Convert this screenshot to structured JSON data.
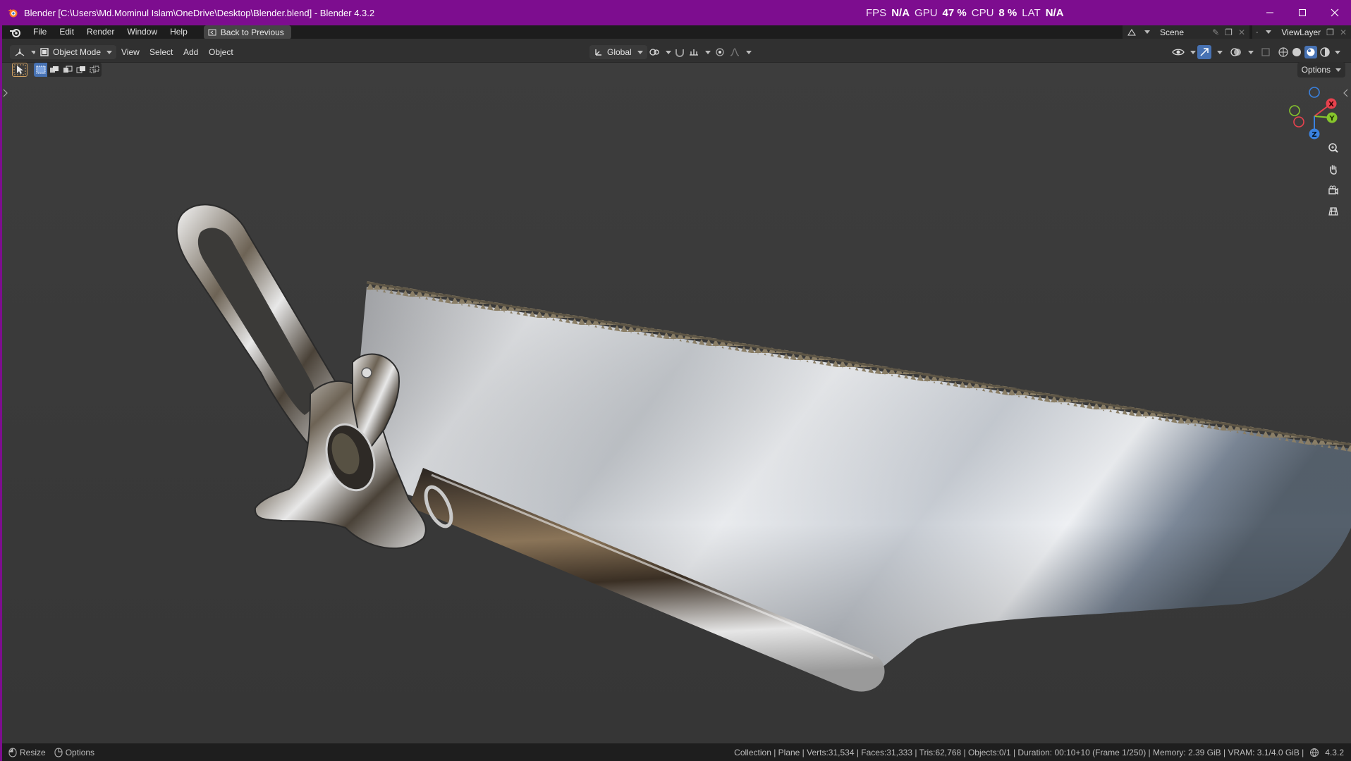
{
  "titlebar": {
    "title": "Blender [C:\\Users\\Md.Mominul Islam\\OneDrive\\Desktop\\Blender.blend] - Blender 4.3.2",
    "perf": {
      "fps_label": "FPS",
      "fps_value": "N/A",
      "gpu_label": "GPU",
      "gpu_value": "47 %",
      "cpu_label": "CPU",
      "cpu_value": "8 %",
      "lat_label": "LAT",
      "lat_value": "N/A"
    },
    "minimize_icon": "minimize-icon",
    "maximize_icon": "maximize-icon",
    "close_icon": "close-icon"
  },
  "menubar": {
    "items": [
      "File",
      "Edit",
      "Render",
      "Window",
      "Help"
    ],
    "back_button": "Back to Previous",
    "scene_name": "Scene",
    "view_layer": "ViewLayer"
  },
  "header": {
    "mode": "Object Mode",
    "menus": [
      "View",
      "Select",
      "Add",
      "Object"
    ],
    "transform_orientation": "Global"
  },
  "toolbar": {
    "options_label": "Options"
  },
  "gizmo": {
    "x_label": "X",
    "y_label": "Y",
    "z_label": "Z"
  },
  "statusbar": {
    "resize_label": "Resize",
    "options_label": "Options",
    "stats": "Collection | Plane | Verts:31,534 | Faces:31,333 | Tris:62,768 | Objects:0/1 | Duration: 00:10+10 (Frame 1/250) | Memory: 2.39 GiB | VRAM: 3.1/4.0 GiB |",
    "version": "4.3.2"
  },
  "colors": {
    "titlebar": "#7d0d8f",
    "viewport_bg": "#3a3a3a",
    "axis_x": "#e8424e",
    "axis_y": "#86c62c",
    "axis_z": "#3a82e0"
  }
}
